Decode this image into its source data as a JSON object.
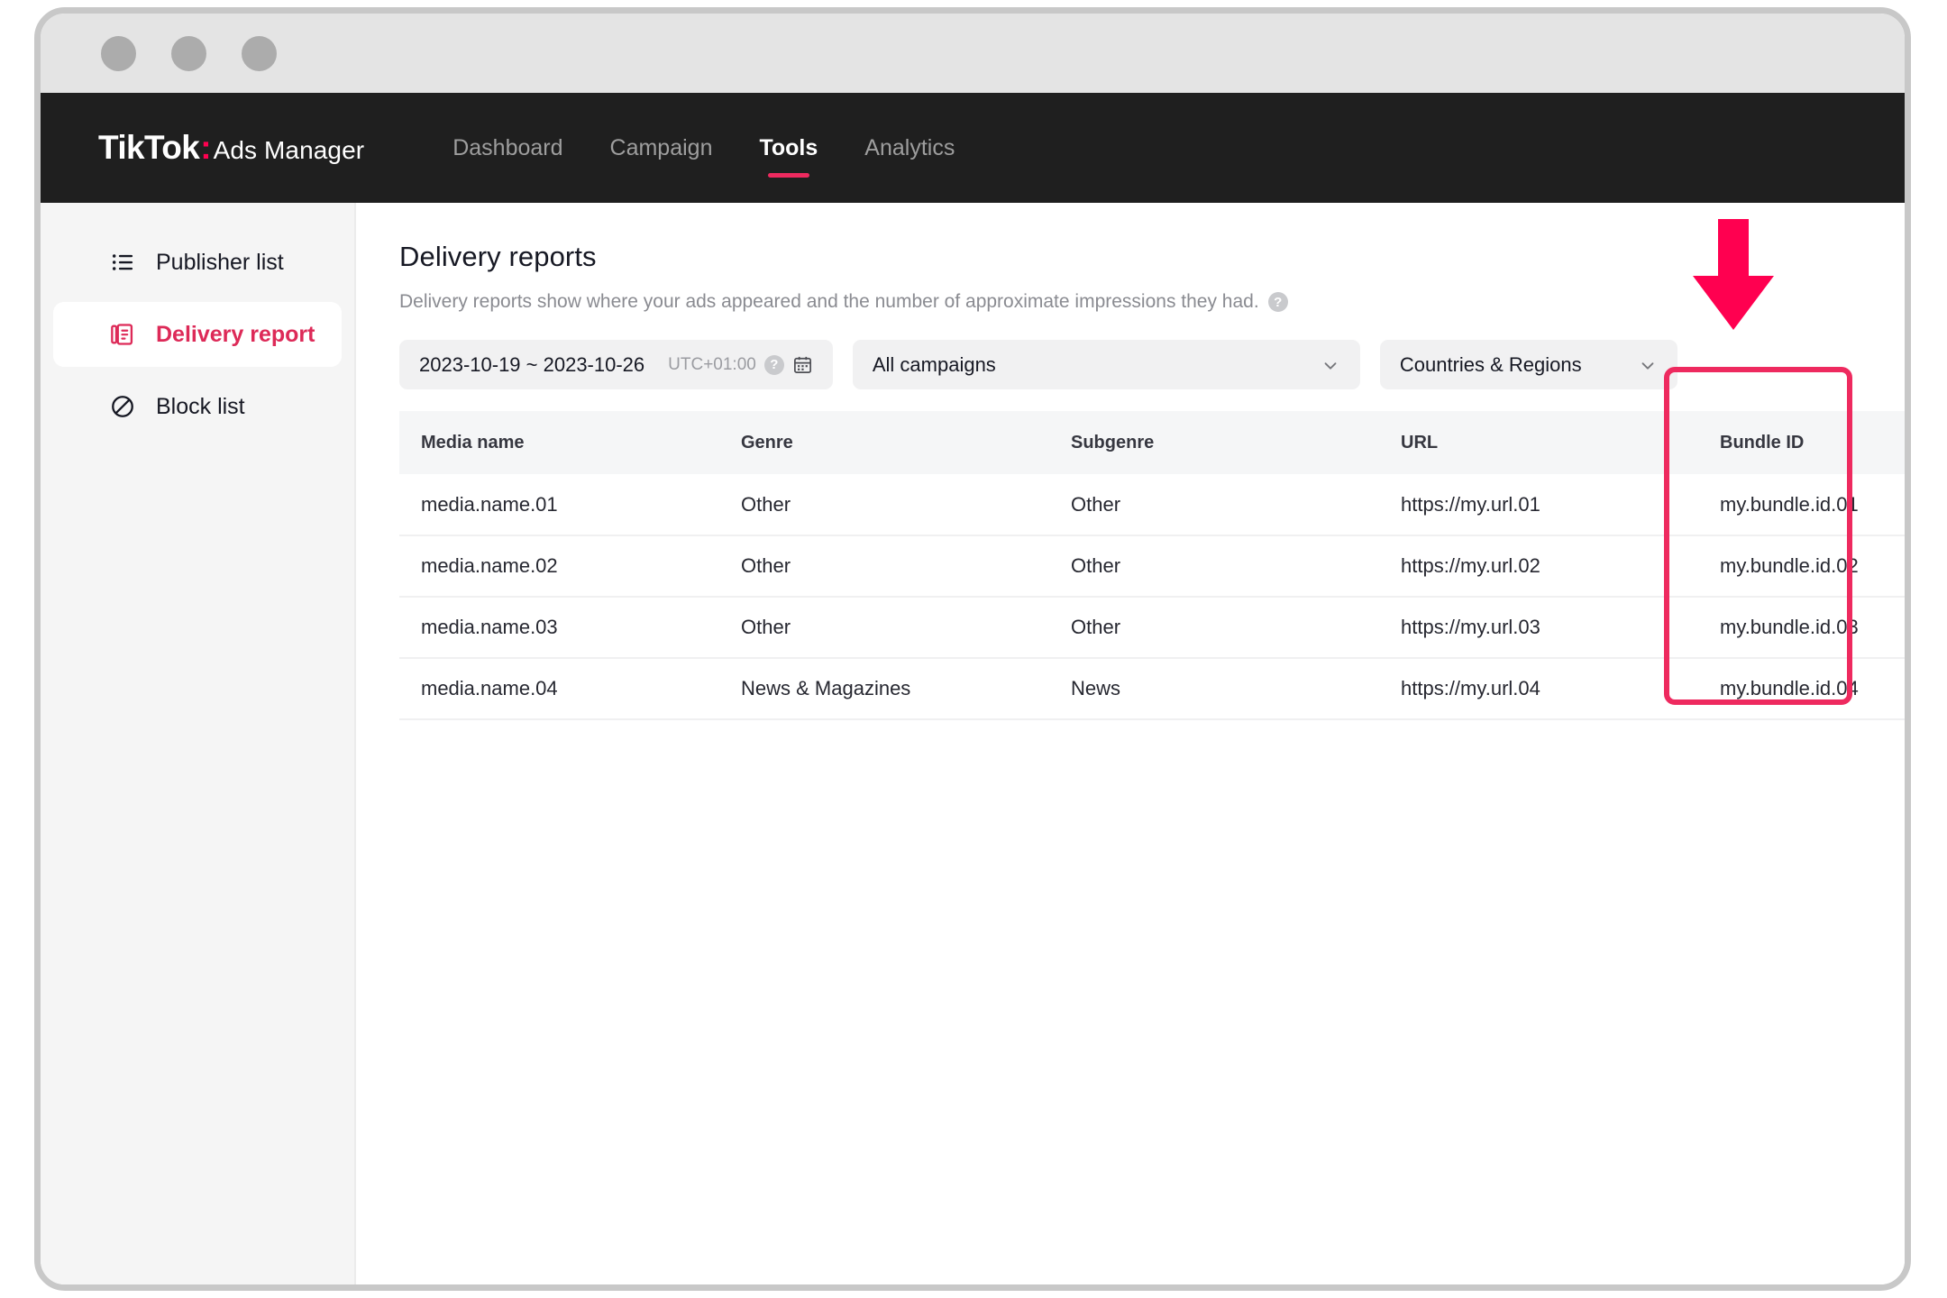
{
  "window": {
    "dots": [
      "close-dot",
      "minimize-dot",
      "maximize-dot"
    ]
  },
  "header": {
    "brand_logo": "TikTok",
    "brand_colon": ":",
    "brand_suffix": "Ads Manager",
    "nav": [
      {
        "label": "Dashboard",
        "active": false
      },
      {
        "label": "Campaign",
        "active": false
      },
      {
        "label": "Tools",
        "active": true
      },
      {
        "label": "Analytics",
        "active": false
      }
    ],
    "active_accent": "#ee2a5f"
  },
  "sidebar": {
    "items": [
      {
        "label": "Publisher list",
        "icon": "list-icon",
        "active": false
      },
      {
        "label": "Delivery report",
        "icon": "document-report-icon",
        "active": true
      },
      {
        "label": "Block list",
        "icon": "block-icon",
        "active": false
      }
    ],
    "active_color": "#dd2a58"
  },
  "main": {
    "title": "Delivery reports",
    "subtitle": "Delivery reports show where your ads appeared and the number of approximate impressions they had.",
    "subtitle_help_glyph": "?",
    "filters": {
      "date_range": "2023-10-19 ~ 2023-10-26",
      "timezone": "UTC+01:00",
      "timezone_help_glyph": "?",
      "calendar_icon": "calendar-icon",
      "campaign_select": "All campaigns",
      "region_select": "Countries & Regions"
    },
    "table": {
      "columns": [
        "Media name",
        "Genre",
        "Subgenre",
        "URL",
        "Bundle ID"
      ],
      "rows": [
        {
          "media_name": "media.name.01",
          "genre": "Other",
          "subgenre": "Other",
          "url": "https://my.url.01",
          "bundle_id": "my.bundle.id.01"
        },
        {
          "media_name": "media.name.02",
          "genre": "Other",
          "subgenre": "Other",
          "url": "https://my.url.02",
          "bundle_id": "my.bundle.id.02"
        },
        {
          "media_name": "media.name.03",
          "genre": "Other",
          "subgenre": "Other",
          "url": "https://my.url.03",
          "bundle_id": "my.bundle.id.03"
        },
        {
          "media_name": "media.name.04",
          "genre": "News & Magazines",
          "subgenre": "News",
          "url": "https://my.url.04",
          "bundle_id": "my.bundle.id.04"
        }
      ]
    }
  },
  "annotation": {
    "highlight_target": "Bundle ID column",
    "highlight_color": "#ee2a5f",
    "arrow_color": "#ff0050",
    "arrow_direction": "down"
  }
}
